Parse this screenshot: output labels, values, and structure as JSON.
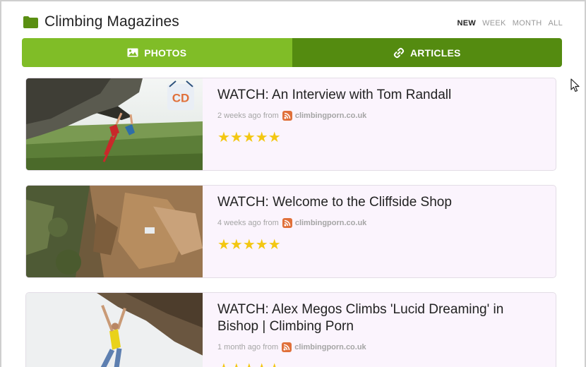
{
  "header": {
    "title": "Climbing Magazines",
    "filters": [
      {
        "label": "NEW",
        "active": true
      },
      {
        "label": "WEEK",
        "active": false
      },
      {
        "label": "MONTH",
        "active": false
      },
      {
        "label": "ALL",
        "active": false
      }
    ]
  },
  "tabs": {
    "photos_label": "PHOTOS",
    "articles_label": "ARTICLES"
  },
  "articles": [
    {
      "title": "WATCH: An Interview with Tom Randall",
      "age": "2 weeks ago from",
      "source": "climbingporn.co.uk",
      "stars": "★★★★★",
      "badge": "CD"
    },
    {
      "title": "WATCH: Welcome to the Cliffside Shop",
      "age": "4 weeks ago from",
      "source": "climbingporn.co.uk",
      "stars": "★★★★★"
    },
    {
      "title": "WATCH: Alex Megos Climbs 'Lucid Dreaming' in Bishop | Climbing Porn",
      "age": "1 month ago from",
      "source": "climbingporn.co.uk",
      "stars": "★★★★★"
    }
  ],
  "colors": {
    "tab_photos": "#80bd27",
    "tab_articles": "#548b10",
    "folder_icon": "#5a8f12",
    "star": "#f3c712",
    "rss": "#e0703a",
    "card_bg": "#fbf4fd"
  }
}
